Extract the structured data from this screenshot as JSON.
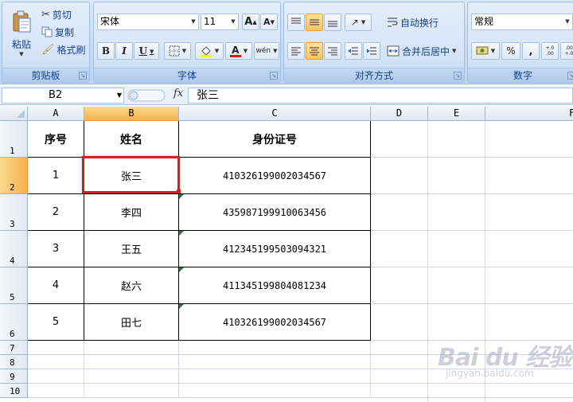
{
  "ribbon": {
    "clipboard": {
      "paste_label": "粘贴",
      "cut_label": "剪切",
      "copy_label": "复制",
      "format_painter_label": "格式刷",
      "group_label": "剪贴板"
    },
    "font": {
      "font_name": "宋体",
      "font_size": "11",
      "grow_label": "A",
      "shrink_label": "A",
      "bold_label": "B",
      "italic_label": "I",
      "underline_label": "U",
      "font_color_label": "A",
      "phonetic_label": "wén",
      "group_label": "字体"
    },
    "alignment": {
      "wrap_text_label": "自动换行",
      "merge_center_label": "合并后居中",
      "group_label": "对齐方式"
    },
    "number": {
      "format_value": "常规",
      "percent_label": "%",
      "comma_label": ",",
      "increase_decimal_label": "+.0 .00",
      "decrease_decimal_label": ".00 +.0",
      "group_label": "数字"
    },
    "colors": {
      "fill_color": "#ffff00",
      "font_color": "#ff0000"
    }
  },
  "formula_bar": {
    "name_box": "B2",
    "fx_label": "fx",
    "content": "张三"
  },
  "sheet": {
    "columns": [
      "A",
      "B",
      "C",
      "D",
      "E",
      "F"
    ],
    "rows": [
      "1",
      "2",
      "3",
      "4",
      "5",
      "6",
      "7",
      "8",
      "9",
      "10"
    ],
    "headers": [
      "序号",
      "姓名",
      "身份证号"
    ],
    "data": [
      {
        "no": "1",
        "name": "张三",
        "id": "410326199002034567"
      },
      {
        "no": "2",
        "name": "李四",
        "id": "435987199910063456"
      },
      {
        "no": "3",
        "name": "王五",
        "id": "412345199503094321"
      },
      {
        "no": "4",
        "name": "赵六",
        "id": "411345199804081234"
      },
      {
        "no": "5",
        "name": "田七",
        "id": "410326199002034567"
      }
    ],
    "selected_cell": "B2",
    "selection_color": "#d81e1e",
    "error_marker_color": "#1e7e34"
  },
  "watermark": {
    "brand": "Bai du 经验",
    "url": "jingyan.baidu.com"
  }
}
